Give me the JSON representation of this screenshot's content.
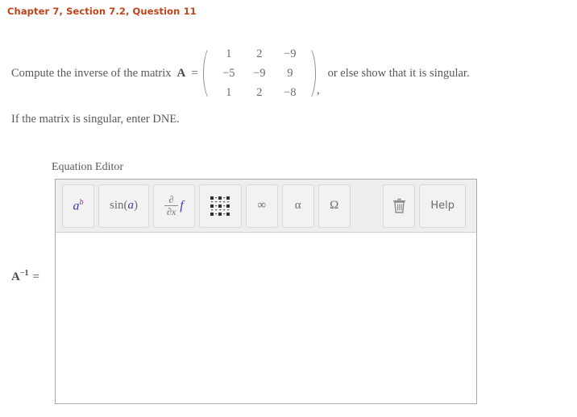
{
  "header": {
    "breadcrumb": "Chapter 7, Section 7.2, Question 11",
    "color": "#BF4219"
  },
  "problem": {
    "prompt": "Compute the inverse of the matrix",
    "matrix_variable": "A",
    "equals": "=",
    "matrix": {
      "rows": [
        [
          "1",
          "2",
          "−9"
        ],
        [
          "−5",
          "−9",
          "9"
        ],
        [
          "1",
          "2",
          "−8"
        ]
      ],
      "left_delimiter": "(",
      "right_delimiter": ")"
    },
    "comma": ",",
    "tail": "or else show that it is singular.",
    "singular_note": "If the matrix is singular, enter DNE."
  },
  "editor": {
    "label": "Equation Editor",
    "toolbar": {
      "buttons": [
        {
          "name": "exponent",
          "icon": "a-superscript-b-icon",
          "base": "a",
          "exponent": "b"
        },
        {
          "name": "trig",
          "icon": "sin-function-icon",
          "fn": "sin",
          "open": "(",
          "arg": "a",
          "close": ")"
        },
        {
          "name": "derivative",
          "icon": "partial-derivative-icon",
          "numerator": "∂",
          "denominator": "∂x",
          "operand": "f"
        },
        {
          "name": "matrix",
          "icon": "matrix-grid-icon"
        },
        {
          "name": "infinity",
          "icon": "infinity-icon",
          "symbol": "∞"
        },
        {
          "name": "alpha",
          "icon": "alpha-icon",
          "symbol": "α"
        },
        {
          "name": "omega",
          "icon": "omega-icon",
          "symbol": "Ω"
        },
        {
          "name": "clear",
          "icon": "trash-icon"
        },
        {
          "name": "help",
          "icon": "help-label",
          "label": "Help"
        }
      ]
    },
    "canvas_value": ""
  },
  "answer": {
    "label_base": "A",
    "label_exponent": "−1",
    "equals": "="
  }
}
